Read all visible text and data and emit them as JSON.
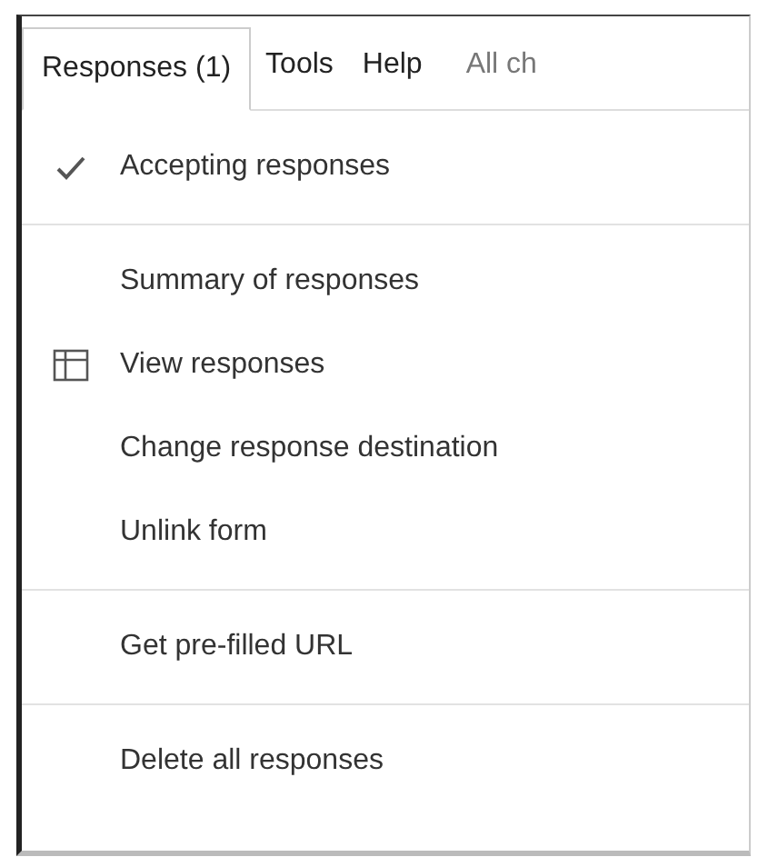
{
  "menu_bar": [
    {
      "label": "Responses (1)",
      "selected": true
    },
    {
      "label": "Tools",
      "selected": false
    },
    {
      "label": "Help",
      "selected": false
    }
  ],
  "status_text": "All ch",
  "menu": {
    "sections": [
      [
        {
          "label": "Accepting responses",
          "kind": "check",
          "checked": true
        }
      ],
      [
        {
          "label": "Summary of responses",
          "kind": "plain"
        },
        {
          "label": "View responses",
          "kind": "table"
        },
        {
          "label": "Change response destination",
          "kind": "plain"
        },
        {
          "label": "Unlink form",
          "kind": "plain"
        }
      ],
      [
        {
          "label": "Get pre-filled URL",
          "kind": "plain"
        }
      ],
      [
        {
          "label": "Delete all responses",
          "kind": "plain"
        }
      ]
    ]
  }
}
